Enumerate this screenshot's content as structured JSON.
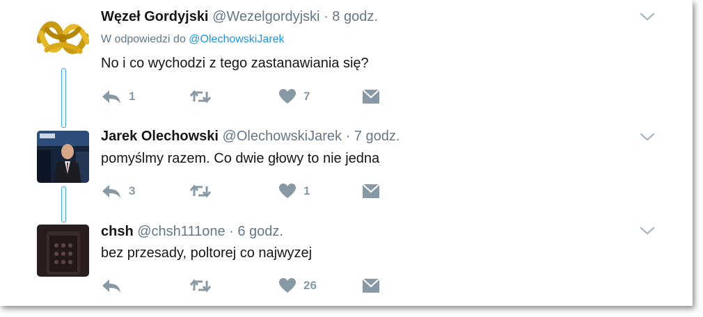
{
  "tweets": [
    {
      "name": "Węzeł Gordyjski",
      "handle": "@Wezelgordyjski",
      "time": "· 8 godz.",
      "reply_prefix": "W odpowiedzi do",
      "reply_mention": "@OlechowskiJarek",
      "text": "No i co wychodzi z tego zastanawiania się?",
      "replies": "1",
      "retweets": "",
      "likes": "7"
    },
    {
      "name": "Jarek Olechowski",
      "handle": "@OlechowskiJarek",
      "time": "· 7 godz.",
      "text": "pomyślmy razem. Co dwie głowy to nie jedna",
      "replies": "3",
      "retweets": "",
      "likes": "1"
    },
    {
      "name": "chsh",
      "handle": "@chsh111one",
      "time": "· 6 godz.",
      "text": "bez przesady, poltorej co najwyzej",
      "replies": "",
      "retweets": "",
      "likes": "26"
    }
  ],
  "icons": {
    "reply": "reply-icon",
    "retweet": "retweet-icon",
    "like": "heart-icon",
    "dm": "envelope-icon",
    "more": "chevron-down-icon"
  },
  "colors": {
    "name": "#14171a",
    "meta": "#657786",
    "link": "#1b95e0",
    "action": "#8899a6",
    "thread": "#4aa3d6"
  }
}
